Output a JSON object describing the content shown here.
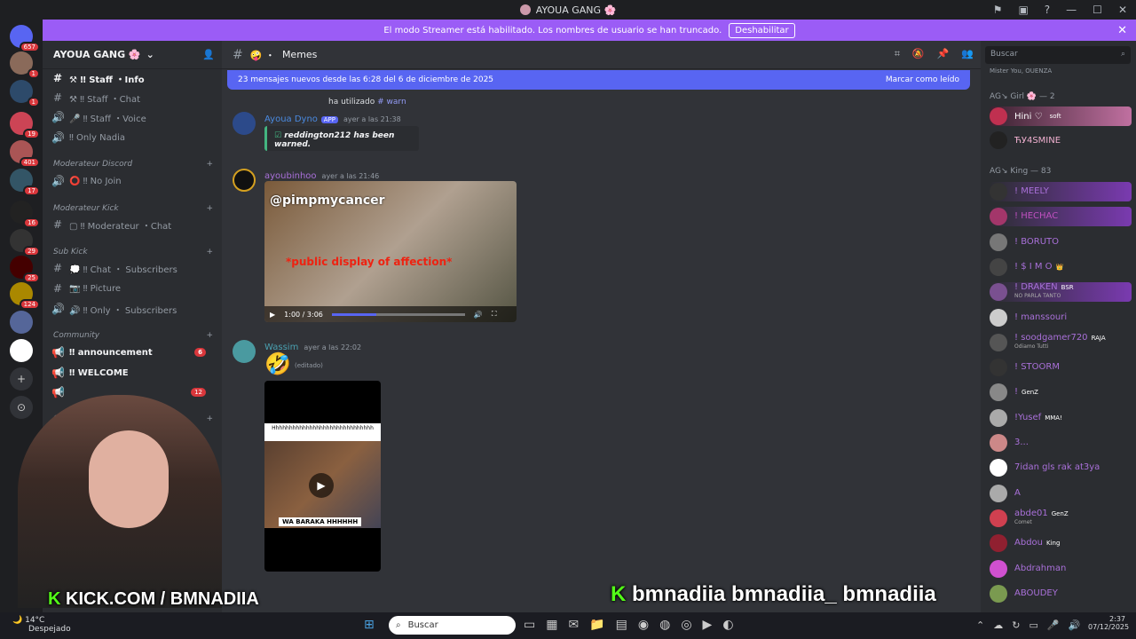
{
  "window": {
    "title": "AYOUA GANG 🌸"
  },
  "banner": {
    "text": "El modo Streamer está habilitado. Los nombres de usuario se han truncado.",
    "button": "Deshabilitar"
  },
  "guilds": {
    "badges": [
      "657",
      "1",
      "1",
      "19",
      "401",
      "17",
      "16",
      "29",
      "25",
      "124"
    ]
  },
  "server": {
    "name": "AYOUA GANG 🌸"
  },
  "channels": [
    {
      "name": "⚒ ‼ Staff ・Info",
      "icon": "#",
      "bold": true
    },
    {
      "name": "⚒ ‼ Staff ・Chat",
      "icon": "#"
    },
    {
      "name": "🎤 ‼ Staff ・Voice",
      "icon": "🔊"
    },
    {
      "name": "‼ Only Nadia",
      "icon": "🔊"
    },
    {
      "name": "⭕ ‼ No Join",
      "icon": "🔊"
    },
    {
      "name": "▢ ‼ Moderateur ・Chat",
      "icon": "#"
    },
    {
      "name": "💭 ‼ Chat ・ Subscribers",
      "icon": "#"
    },
    {
      "name": "📷 ‼ Picture",
      "icon": "#"
    },
    {
      "name": "🔊 ‼ Only ・ Subscribers",
      "icon": "🔊"
    },
    {
      "name": "‼ announcement",
      "icon": "📢",
      "bold": true,
      "badge": "6"
    },
    {
      "name": "‼ WELCOME",
      "icon": "📢",
      "bold": true
    },
    {
      "name": "",
      "icon": "📢",
      "badge": "12"
    }
  ],
  "categories": [
    "Moderateur Discord",
    "Moderateur Kick",
    "Sub Kick",
    "Community",
    "Ge"
  ],
  "chat": {
    "channel": "Memes",
    "new_messages": "23 mensajes nuevos desde las 6:28 del 6 de diciembre de 2025",
    "mark_read": "Marcar como leído",
    "msg1": {
      "system": "ha utilizado",
      "cmd": "# warn",
      "user": "Ayoua Dyno",
      "tag": "APP",
      "ts": "ayer a las 21:38",
      "embed": "reddington212 has been warned."
    },
    "msg2": {
      "user": "ayoubinhoo",
      "ts": "ayer a las 21:46",
      "video_caption": "@pimpmycancer",
      "video_sub": "*public display of affection*",
      "time": "1:00 / 3:06"
    },
    "msg3": {
      "user": "Wassim",
      "ts": "ayer a las 22:02",
      "edited": "(editado)",
      "video_text": "Hhhhhhhhhhhhhhhhhhhhhhhhhhhhhh",
      "video_label": "WA BARAKA HHHHHH"
    }
  },
  "members": {
    "search": "Buscar",
    "top": "Mister You, OUENZA",
    "group1": "AG↘ Girl 🌸 — 2",
    "girls": [
      "Hini ♡",
      "ЋУ4SMINE"
    ],
    "girls_tags": [
      "soft",
      ""
    ],
    "group2": "AG↘ King — 83",
    "kings": [
      "! MEELY",
      "! HECHAC",
      "! BORUTO",
      "! $ I M O",
      "! DRAKEN",
      "! manssouri",
      "! soodgamer720",
      "! STOORM",
      "!",
      "!Yusef",
      "3...",
      "7idan gls rak at3ya",
      "A",
      "abde01",
      "Abdou",
      "Abdrahman",
      "ABOUDEY"
    ],
    "kings_tags": [
      "",
      "",
      "",
      "👑",
      "BSR",
      "",
      "RAJA",
      "",
      "GenZ",
      "MMA!",
      "",
      "",
      "",
      "GenZ",
      "King",
      "",
      ""
    ],
    "kings_sub": [
      "",
      "",
      "",
      "",
      "NO PARLA TANTO",
      "",
      "Odiamo Tutti",
      "",
      "",
      "",
      "",
      "",
      "",
      "Comet",
      "",
      "",
      ""
    ]
  },
  "overlay": {
    "kick": "KICK.COM / BMNADIIA",
    "handles": "bmnadiia bmnadiia_ bmnadiia"
  },
  "taskbar": {
    "weather": "14°C",
    "weather_desc": "Despejado",
    "search": "Buscar",
    "time": "2:37",
    "date": "07/12/2025"
  }
}
